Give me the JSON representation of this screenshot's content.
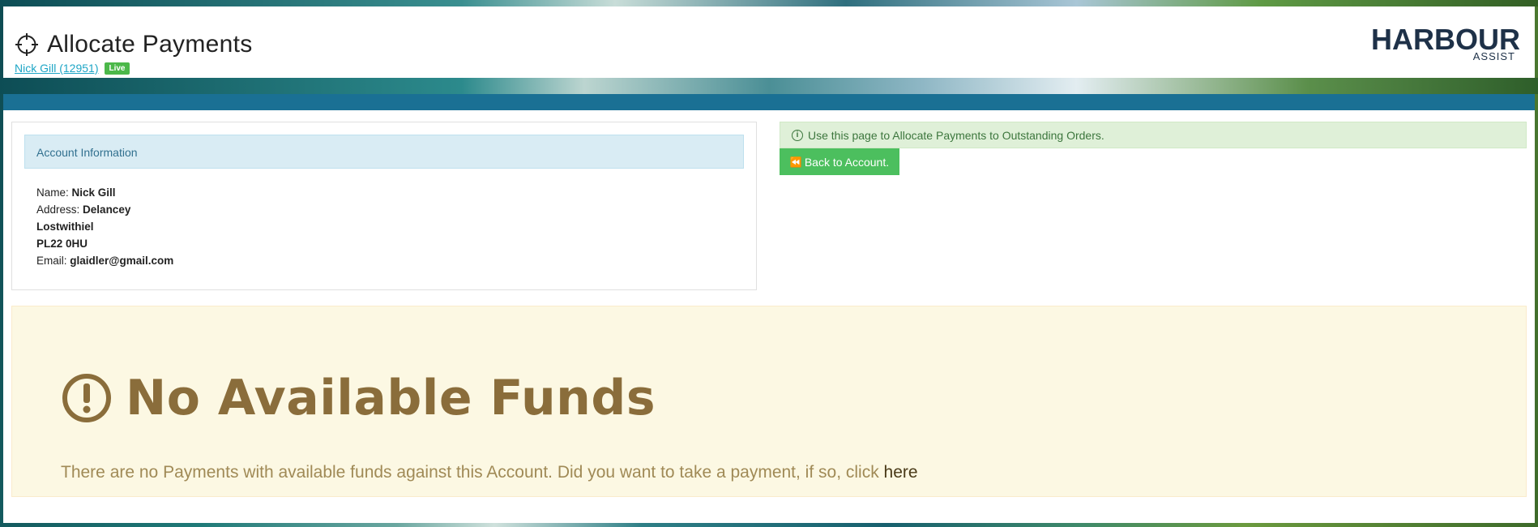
{
  "header": {
    "title": "Allocate Payments",
    "user_link": "Nick Gill (12951)",
    "status_badge": "Live",
    "logo_main": "HARBOUR",
    "logo_sub": "ASSIST"
  },
  "account_panel": {
    "heading": "Account Information",
    "name_label": "Name:",
    "name_value": "Nick Gill",
    "address_label": "Address:",
    "address_line1": "Delancey",
    "address_line2": "Lostwithiel",
    "address_line3": "PL22 0HU",
    "email_label": "Email:",
    "email_value": "glaidler@gmail.com"
  },
  "info_alert": {
    "icon": "info-icon",
    "text": "Use this page to Allocate Payments to Outstanding Orders."
  },
  "back_button": {
    "icon": "fast-backward-icon",
    "label": "Back to Account."
  },
  "warning": {
    "icon": "exclamation-circle-icon",
    "title": "No Available Funds",
    "text": "There are no Payments with available funds against this Account. Did you want to take a payment, if so, click",
    "link_text": "here"
  },
  "colors": {
    "accent_blue": "#1a7094",
    "success_green": "#4cbf5e",
    "warning_text": "#8a6d3b",
    "info_heading_bg": "#d9ecf4",
    "logo_navy": "#1e3148"
  }
}
